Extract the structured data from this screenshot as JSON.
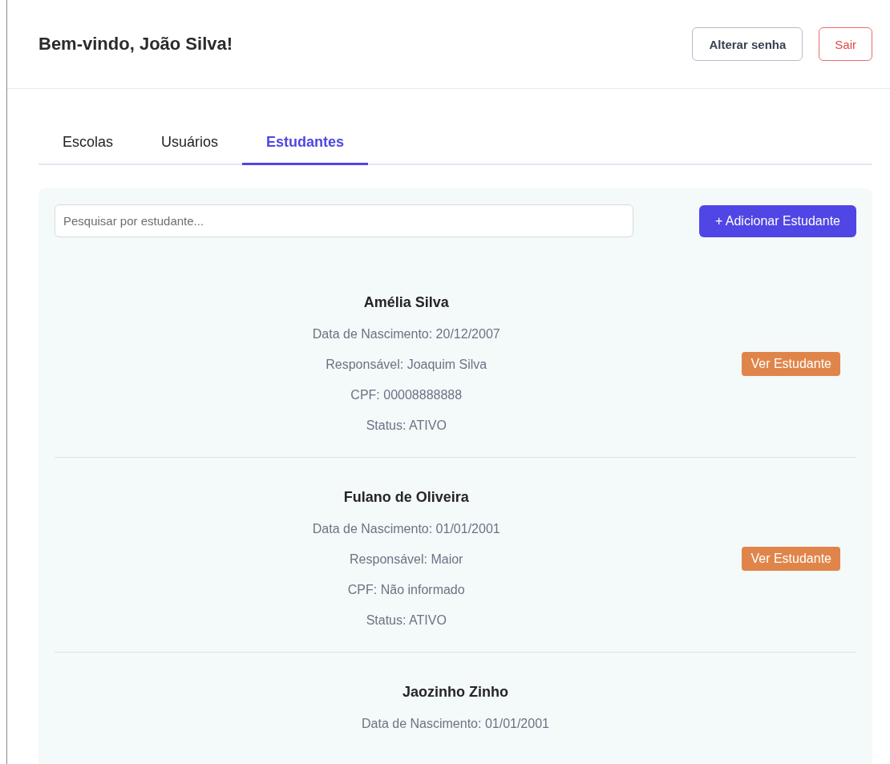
{
  "header": {
    "title": "Bem-vindo, João Silva!",
    "buttons": [
      {
        "label": "Alterar senha",
        "kind": "secondary"
      },
      {
        "label": "Sair",
        "kind": "danger"
      }
    ]
  },
  "tabs": [
    {
      "label": "Escolas",
      "selected": false
    },
    {
      "label": "Usuários",
      "selected": false
    },
    {
      "label": "Estudantes",
      "selected": true
    }
  ],
  "search": {
    "placeholder": "Pesquisar por estudante..."
  },
  "add_button": "+ Adicionar Estudante",
  "students": [
    {
      "name": "Amélia Silva",
      "details": [
        "Data de Nascimento: 20/12/2007",
        "Responsável: Joaquim Silva",
        "CPF: 00008888888",
        "Status: ATIVO"
      ],
      "button": "Ver Estudante"
    },
    {
      "name": "Fulano de Oliveira",
      "details": [
        "Data de Nascimento: 01/01/2001",
        "Responsável: Maior",
        "CPF: Não informado",
        "Status: ATIVO"
      ],
      "button": "Ver Estudante"
    },
    {
      "name": "Jaozinho Zinho",
      "details": [
        "Data de Nascimento: 01/01/2001"
      ]
    }
  ]
}
